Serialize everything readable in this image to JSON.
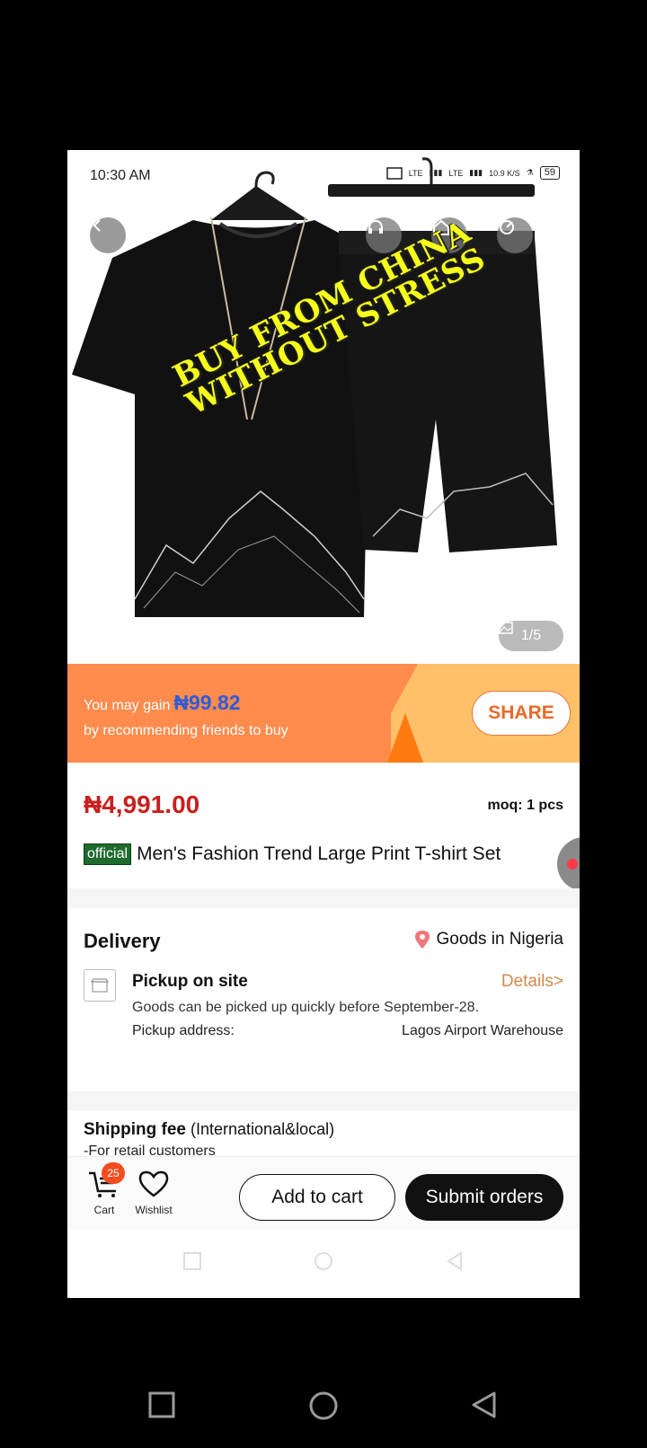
{
  "status": {
    "time": "10:30 AM",
    "net1": "LTE",
    "net2": "LTE",
    "speed": "10.9",
    "speed_unit": "K/S",
    "battery": "59"
  },
  "hero": {
    "promo_line1": "BUY FROM CHINA",
    "promo_line2": "WITHOUT STRESS",
    "image_counter": "1/5"
  },
  "banner": {
    "prefix": "You may gain",
    "amount": "₦99.82",
    "line2": "by recommending friends to buy",
    "share_label": "SHARE",
    "colors": {
      "left": "#ff8b4d",
      "right": "#ffc06a",
      "amount": "#2f5bd8"
    }
  },
  "product": {
    "price": "₦4,991.00",
    "moq": "moq: 1 pcs",
    "badge": "official",
    "title": "Men's Fashion Trend Large Print T-shirt Set"
  },
  "delivery": {
    "title": "Delivery",
    "location": "Goods in Nigeria",
    "pickup_title": "Pickup on site",
    "details_link": "Details>",
    "pickup_desc": "Goods can be picked up quickly before September-28.",
    "address_label": "Pickup address:",
    "address_value": "Lagos Airport Warehouse"
  },
  "shipping": {
    "title": "Shipping fee",
    "title_suffix": "(International&local)",
    "sub": "-For retail customers"
  },
  "bottom_bar": {
    "cart_label": "Cart",
    "cart_count": "25",
    "wishlist_label": "Wishlist",
    "add_to_cart": "Add to cart",
    "submit_orders": "Submit orders"
  }
}
